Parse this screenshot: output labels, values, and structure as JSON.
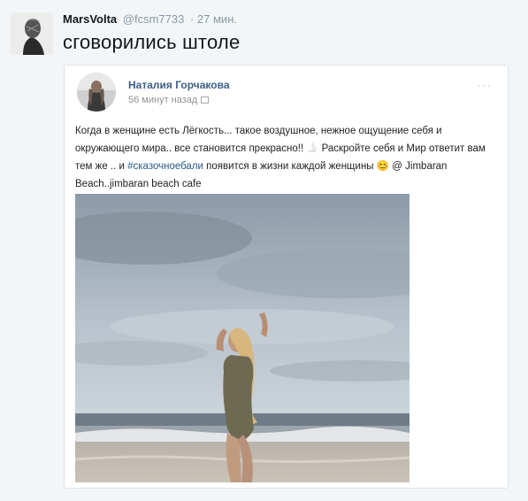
{
  "tweet": {
    "author_name": "MarsVolta",
    "author_handle": "@fcsm7733",
    "time": "· 27 мин.",
    "text": "сговорились штоле"
  },
  "embedded_post": {
    "author_name": "Наталия Горчакова",
    "time": "56 минут назад",
    "text_part1": "Когда в женщине есть Лёгкость... такое воздушное, нежное ощущение себя и окружающего мира.. все становится прекрасно!! ",
    "text_part2": " Раскройте себя и Мир ответит вам тем же .. и ",
    "hashtag": "#сказочноебали",
    "text_part3": " появится в жизни каждой женщины ",
    "emoji": "😊",
    "text_part4": " @ Jimbaran Beach..jimbaran beach cafe",
    "more": "···",
    "photo_icon": "beach-photo"
  },
  "colors": {
    "vk_name": "#3f5f86",
    "link": "#2a5885",
    "handle": "#8899a6"
  }
}
